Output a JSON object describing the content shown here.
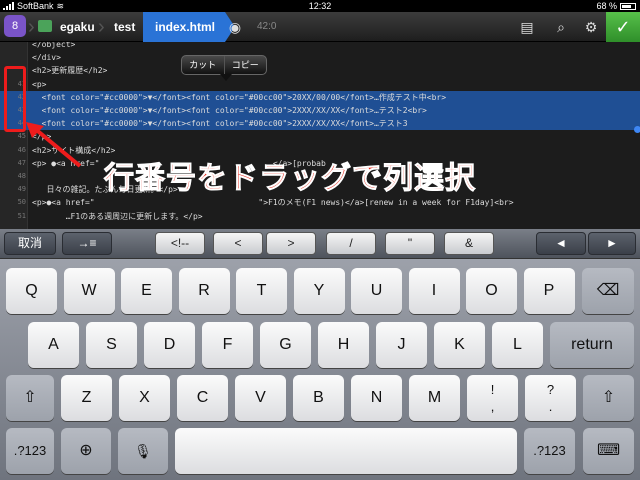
{
  "status": {
    "carrier": "SoftBank",
    "time": "12:32",
    "battery": "68 %"
  },
  "toolbar": {
    "app_badge": "8",
    "crumbs": [
      "egaku",
      "test",
      "index.html"
    ],
    "cursor_pos": "42:0"
  },
  "editor": {
    "lines": [
      {
        "num": "",
        "text": "</object>"
      },
      {
        "num": "",
        "text": "</div>"
      },
      {
        "num": "",
        "text": "<h2>更新履歴</h2>"
      },
      {
        "num": "41",
        "text": "<p>"
      },
      {
        "num": "42",
        "text": "  <font color=\"#cc0000\">▼</font><font color=\"#00cc00\">20XX/00/00</font>…作成テスト中<br>"
      },
      {
        "num": "43",
        "text": "  <font color=\"#cc0000\">▼</font><font color=\"#00cc00\">2XXX/XX/XX</font>…テスト2<br>"
      },
      {
        "num": "44",
        "text": "  <font color=\"#cc0000\">▼</font><font color=\"#00cc00\">2XXX/XX/XX</font>…テスト3"
      },
      {
        "num": "45",
        "text": "</p>"
      },
      {
        "num": "46",
        "text": "<h2>サイト構成</h2>"
      },
      {
        "num": "47",
        "text": "<p> ●<a href=\"                                    </a>[probab"
      },
      {
        "num": "48",
        "text": ""
      },
      {
        "num": "49",
        "text": "   日々の雑記。たぶん毎日更新。</p>"
      },
      {
        "num": "50",
        "text": "<p>●<a href=\"                                  \">F1のメモ(F1 news)</a>[renew in a week for F1day]<br>"
      },
      {
        "num": "51",
        "text": "       …F1のある週周辺に更新します。</p>"
      }
    ],
    "selected_lines": [
      "42",
      "43",
      "44"
    ],
    "popup": {
      "cut": "カット",
      "copy": "コピー"
    },
    "caption": "行番号をドラッグで列選択",
    "caption_color": "#e82a1c"
  },
  "keyboard": {
    "accessory": {
      "cancel": "取消",
      "indent": "→≡",
      "comment": "<!--",
      "lt": "<",
      "gt": ">",
      "slash": "/",
      "quote": "\"",
      "amp": "&",
      "left": "◄",
      "right": "►"
    },
    "row1": [
      "Q",
      "W",
      "E",
      "R",
      "T",
      "Y",
      "U",
      "I",
      "O",
      "P"
    ],
    "row2": [
      "A",
      "S",
      "D",
      "F",
      "G",
      "H",
      "J",
      "K",
      "L"
    ],
    "row3": [
      "Z",
      "X",
      "C",
      "V",
      "B",
      "N",
      "M"
    ],
    "punct1": {
      "top": "!",
      "bottom": ","
    },
    "punct2": {
      "top": "?",
      "bottom": "."
    },
    "return": "return",
    "numkey": ".?123",
    "numkey2": ".?123",
    "accent_colors": {
      "selection": "#1f4f94",
      "active_tab": "#2a73d6",
      "ok": "#4caf3a"
    }
  }
}
